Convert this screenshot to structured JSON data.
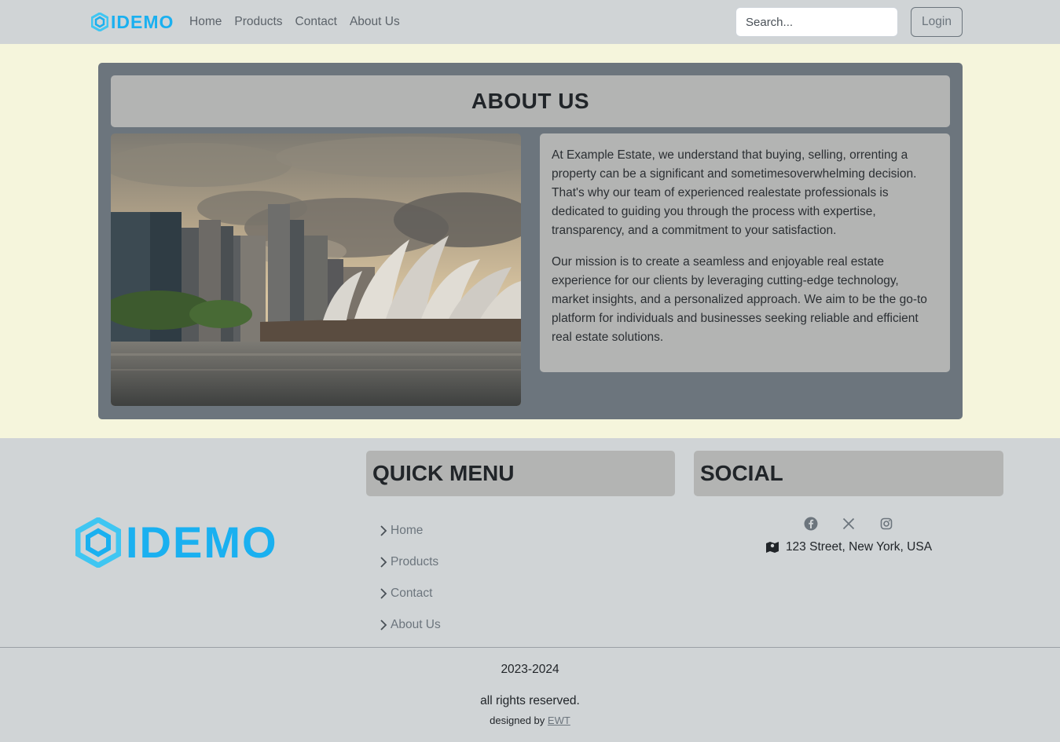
{
  "navbar": {
    "brand": "IDEMO",
    "links": [
      "Home",
      "Products",
      "Contact",
      "About Us"
    ],
    "search_placeholder": "Search...",
    "login_label": "Login"
  },
  "about": {
    "title": "ABOUT US",
    "image_alt": "Sydney Opera House and city skyline at sunset",
    "paragraphs": [
      "At Example Estate, we understand that buying, selling, orrenting a property can be a significant and sometimesoverwhelming decision. That's why our team of experienced realestate professionals is dedicated to guiding you through the process with expertise, transparency, and a commitment to your satisfaction.",
      "Our mission is to create a seamless and enjoyable real estate experience for our clients by leveraging cutting-edge technology, market insights, and a personalized approach. We aim to be the go-to platform for individuals and businesses seeking reliable and efficient real estate solutions."
    ]
  },
  "footer": {
    "brand": "IDEMO",
    "quick_menu_title": "QUICK MENU",
    "quick_menu": [
      "Home",
      "Products",
      "Contact",
      "About Us"
    ],
    "social_title": "SOCIAL",
    "social_icons": [
      "facebook-icon",
      "x-icon",
      "instagram-icon"
    ],
    "address": "123 Street, New York, USA",
    "years": "2023-2024",
    "rights": "all rights reserved.",
    "designed_by_prefix": "designed by",
    "designer": "EWT"
  },
  "colors": {
    "brand_blue": "#1ab0f0",
    "navbar_bg": "#d0d4d6",
    "page_bg": "#f5f5dc",
    "card_bg": "#6c757d",
    "box_bg": "#b3b4b3"
  }
}
